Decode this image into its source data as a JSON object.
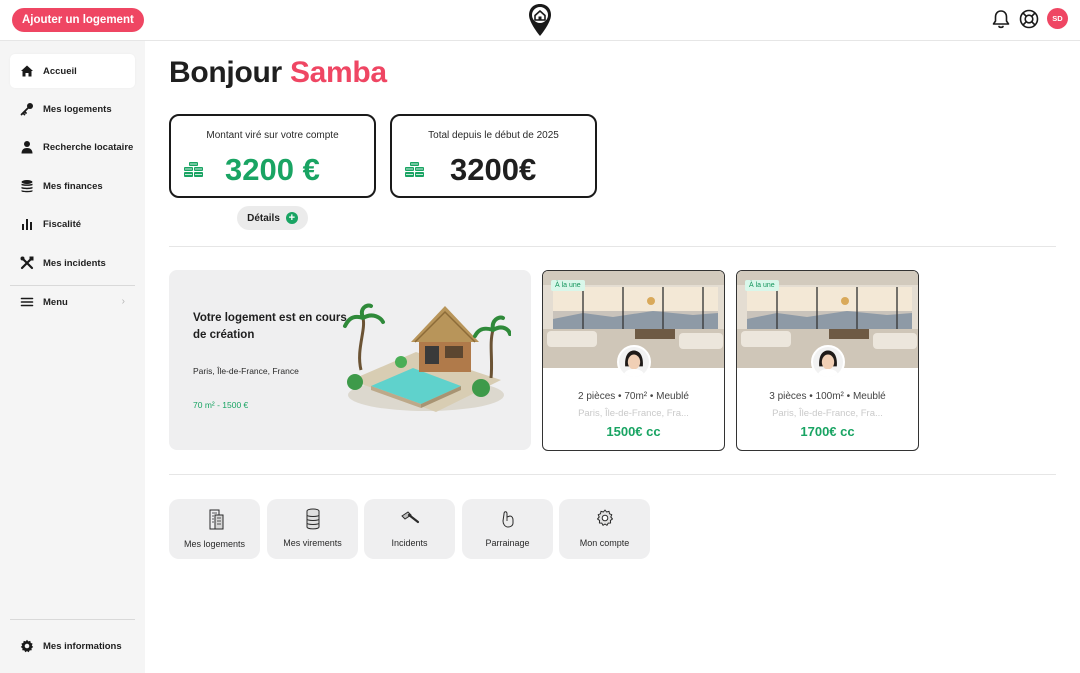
{
  "header": {
    "add_button": "Ajouter un logement",
    "logo_icon": "home-pin-logo-icon",
    "notification_icon": "bell-icon",
    "support_icon": "lifebuoy-icon",
    "avatar_initials": "SD",
    "accent_color": "#ef4663"
  },
  "sidebar": {
    "items": [
      {
        "label": "Accueil",
        "icon": "home-icon",
        "active": true
      },
      {
        "label": "Mes logements",
        "icon": "key-icon"
      },
      {
        "label": "Recherche locataire",
        "icon": "user-icon"
      },
      {
        "label": "Mes finances",
        "icon": "coins-stack-icon"
      },
      {
        "label": "Fiscalité",
        "icon": "bar-chart-icon"
      },
      {
        "label": "Mes incidents",
        "icon": "tools-icon"
      }
    ],
    "menu": {
      "label": "Menu",
      "icon": "hamburger-icon"
    },
    "footer": {
      "label": "Mes informations",
      "icon": "gear-icon"
    }
  },
  "greeting": {
    "prefix": "Bonjour",
    "name": "Samba"
  },
  "stats": [
    {
      "caption": "Montant viré sur votre compte",
      "value": "3200 €",
      "value_color": "#19a463",
      "icon": "money-stack-icon"
    },
    {
      "caption": "Total depuis le début de 2025",
      "value": "3200€",
      "value_color": "#1f1f1f",
      "icon": "money-stack-icon"
    }
  ],
  "details_button": "Détails",
  "creation": {
    "title": "Votre logement est en cours de création",
    "location": "Paris, Île-de-France, France",
    "meta": "70 m² - 1500 €",
    "illustration": "house-with-pool-illustration"
  },
  "listings": [
    {
      "badge": "À la une",
      "specs": "2 pièces  •  70m²  •  Meublé",
      "address": "Paris, Île-de-France, Fra...",
      "price": "1500€ cc"
    },
    {
      "badge": "À la une",
      "specs": "3 pièces  •  100m²  •  Meublé",
      "address": "Paris, Île-de-France, Fra...",
      "price": "1700€ cc"
    }
  ],
  "shortcuts": [
    {
      "label": "Mes logements",
      "icon": "buildings-icon"
    },
    {
      "label": "Mes virements",
      "icon": "coin-stack-icon"
    },
    {
      "label": "Incidents",
      "icon": "hammer-icon"
    },
    {
      "label": "Parrainage",
      "icon": "hand-icon"
    },
    {
      "label": "Mon compte",
      "icon": "gear-outline-icon"
    }
  ],
  "colors": {
    "accent": "#ef4663",
    "success": "#19a463",
    "sidebar_bg": "#f5f5f5",
    "card_bg": "#efeff0"
  }
}
